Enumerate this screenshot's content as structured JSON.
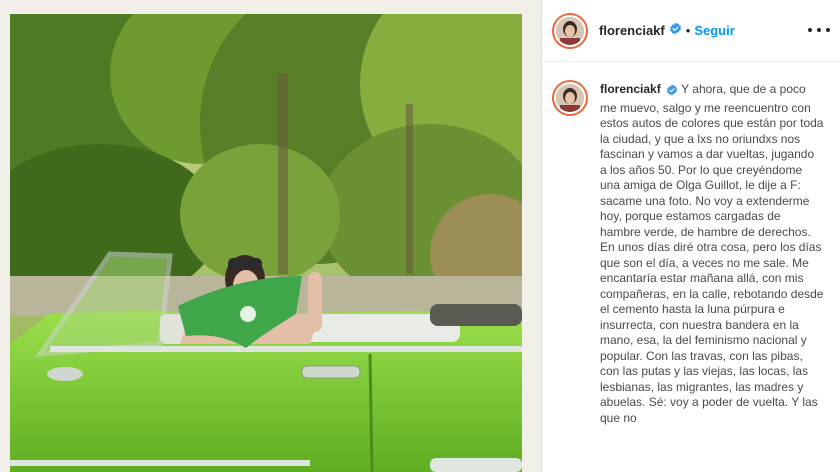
{
  "post": {
    "username": "florenciakf",
    "verified_icon": "verified-badge-icon",
    "separator": "•",
    "follow_label": "Seguir",
    "more_icon": "more-options-icon",
    "caption": "Y ahora, que de a poco me muevo, salgo y me reencuentro con estos autos de colores que están por toda la ciudad, y que a lxs no oriundxs nos fascinan y vamos a dar vueltas, jugando a los años 50. Por lo que creyéndome una amiga de Olga Guillot, le dije a F: sacame una foto. No voy a extenderme hoy, porque estamos cargadas de hambre verde, de hambre de derechos. En unos días diré otra cosa, pero los días que son el día, a veces no me sale. Me encantaría estar mañana allá, con mis compañeras, en la calle, rebotando desde el cemento hasta la luna púrpura e insurrecta, con nuestra bandera en la mano, esa, la del feminismo nacional y popular. Con las travas, con las pibas, con las putas y las viejas, las locas, las lesbianas, las migrantes, las madres y abuelas. Sé: voy a poder de vuelta. Y las que no"
  },
  "colors": {
    "follow": "#0095f6",
    "verified": "#3897f0",
    "car_green": "#7fcf3a",
    "scarf_green": "#3fa64a"
  }
}
